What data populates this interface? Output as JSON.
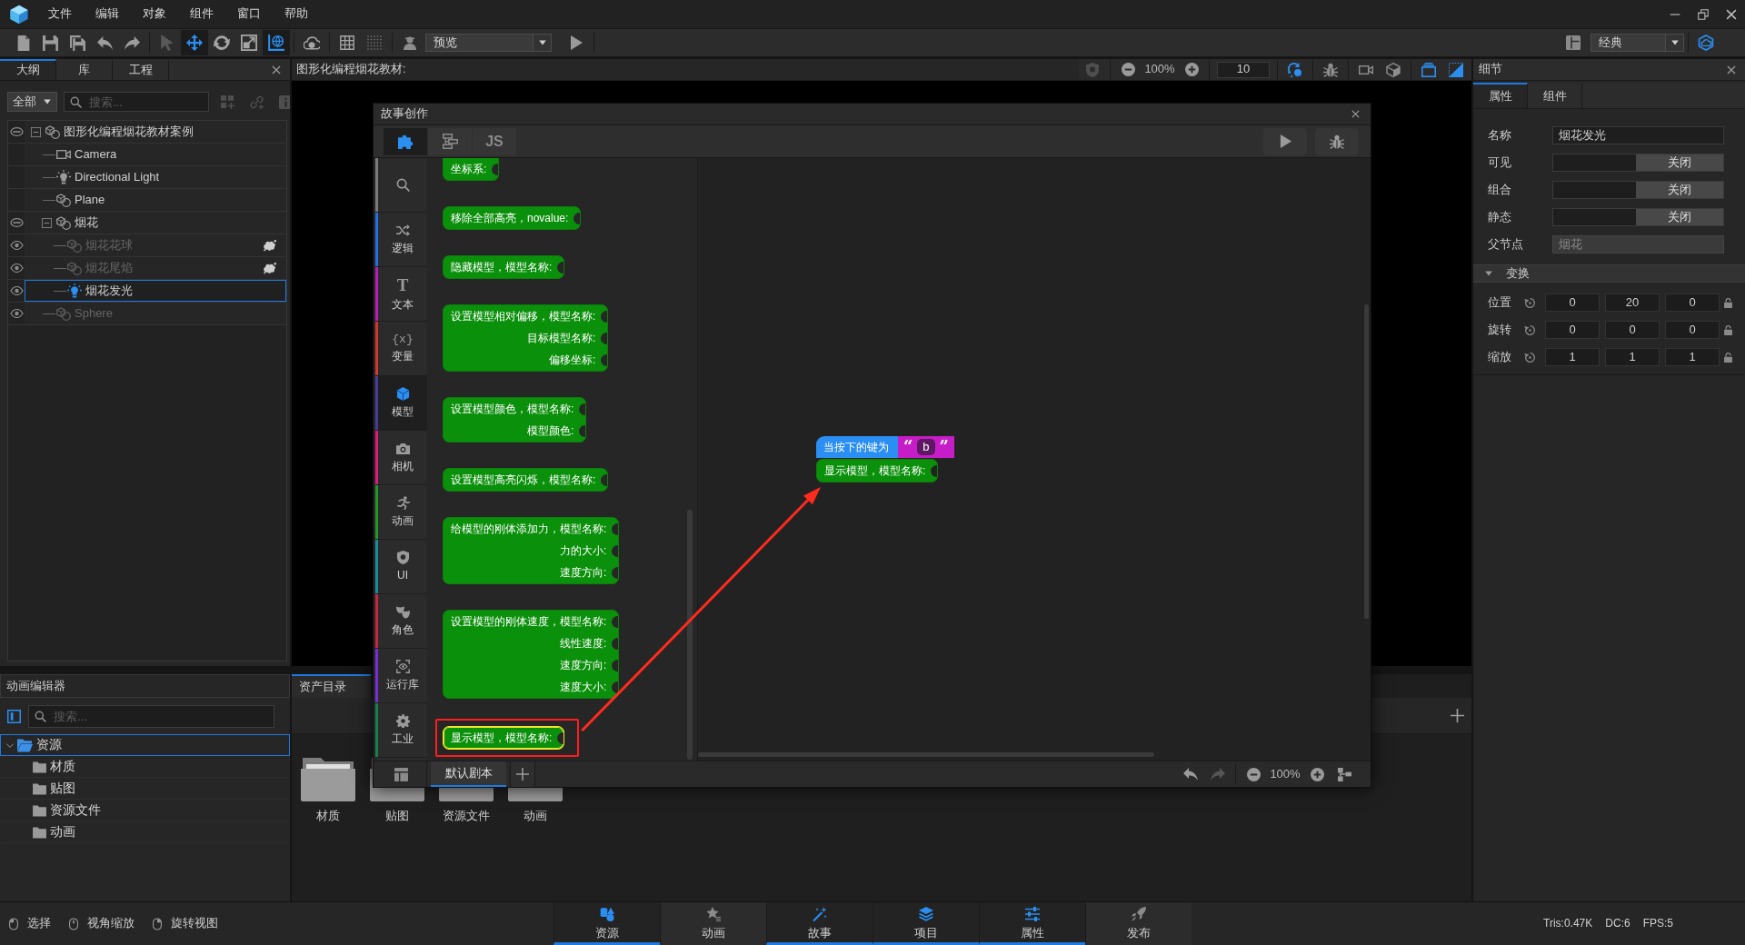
{
  "menu": [
    "文件",
    "编辑",
    "对象",
    "组件",
    "窗口",
    "帮助"
  ],
  "toolbar": {
    "tools": [
      {
        "kind": "select",
        "selected": false,
        "disabled": true
      },
      {
        "kind": "move",
        "selected": true,
        "disabled": false
      },
      {
        "kind": "rotate",
        "selected": false,
        "disabled": false
      },
      {
        "kind": "scale",
        "selected": false,
        "disabled": false
      },
      {
        "kind": "world",
        "selected": true,
        "disabled": false
      }
    ],
    "mode": "预览",
    "layout": "经典"
  },
  "outline": {
    "tabs": [
      {
        "label": "大纲",
        "selected": true
      },
      {
        "label": "库",
        "selected": false
      },
      {
        "label": "工程",
        "selected": false
      }
    ],
    "filter": "全部",
    "search": {
      "placeholder": "搜索..."
    },
    "tree": [
      {
        "label": "图形化编程烟花教材案例",
        "kind": "model",
        "visibility_toggle": true,
        "expanded": true,
        "selected": false,
        "dimmed": false,
        "effect": false,
        "children": [
          {
            "label": "Camera",
            "kind": "camera",
            "visibility_toggle": false,
            "selected": false,
            "dimmed": false,
            "effect": false
          },
          {
            "label": "Directional Light",
            "kind": "light",
            "visibility_toggle": false,
            "selected": false,
            "dimmed": false,
            "effect": false
          },
          {
            "label": "Plane",
            "kind": "model",
            "visibility_toggle": false,
            "selected": false,
            "dimmed": false,
            "effect": false
          },
          {
            "label": "烟花",
            "kind": "model",
            "visibility_toggle": true,
            "expanded": true,
            "selected": false,
            "dimmed": false,
            "effect": false,
            "children": [
              {
                "label": "烟花花球",
                "kind": "model",
                "visibility_toggle": true,
                "selected": false,
                "dimmed": true,
                "effect": true
              },
              {
                "label": "烟花尾焰",
                "kind": "model",
                "visibility_toggle": true,
                "selected": false,
                "dimmed": true,
                "effect": true
              },
              {
                "label": "烟花发光",
                "kind": "light",
                "visibility_toggle": true,
                "selected": true,
                "dimmed": false,
                "effect": false
              }
            ]
          },
          {
            "label": "Sphere",
            "kind": "model",
            "visibility_toggle": true,
            "selected": false,
            "dimmed": true,
            "effect": false
          }
        ]
      }
    ]
  },
  "viewport": {
    "title": "图形化编程烟花教材:",
    "zoom": "100%",
    "grid_size": "10",
    "toggles": [
      {
        "kind": "snap",
        "selected": true
      },
      {
        "kind": "debug",
        "selected": false
      },
      {
        "kind": "camera",
        "selected": false
      },
      {
        "kind": "cube",
        "selected": false
      },
      {
        "kind": "layers",
        "selected": true
      },
      {
        "kind": "gradient",
        "selected": true
      }
    ]
  },
  "details": {
    "title": "细节",
    "tabs": [
      {
        "label": "属性",
        "selected": true
      },
      {
        "label": "组件",
        "selected": false
      }
    ],
    "fields": [
      {
        "label": "名称",
        "kind": "text",
        "value": "烟花发光",
        "disabled": false
      },
      {
        "label": "可见",
        "kind": "toggle",
        "value": "关闭",
        "on": false
      },
      {
        "label": "组合",
        "kind": "toggle",
        "value": "关闭",
        "on": false
      },
      {
        "label": "静态",
        "kind": "toggle",
        "value": "关闭",
        "on": false
      },
      {
        "label": "父节点",
        "kind": "text",
        "value": "烟花",
        "disabled": true
      }
    ],
    "section": {
      "title": "变换",
      "expanded": true,
      "rows": [
        {
          "label": "位置",
          "values": [
            "0",
            "20",
            "0"
          ]
        },
        {
          "label": "旋转",
          "values": [
            "0",
            "0",
            "0"
          ]
        },
        {
          "label": "缩放",
          "values": [
            "1",
            "1",
            "1"
          ]
        }
      ]
    }
  },
  "animation_editor": {
    "title": "动画编辑器",
    "search": {
      "placeholder": "搜索..."
    },
    "tree": [
      {
        "label": "资源",
        "expanded": true,
        "selected": true,
        "children": [
          {
            "label": "材质",
            "selected": false
          },
          {
            "label": "贴图",
            "selected": false
          },
          {
            "label": "资源文件",
            "selected": false
          },
          {
            "label": "动画",
            "selected": false
          }
        ]
      }
    ]
  },
  "assets": {
    "tab": "资产目录",
    "folders": [
      "材质",
      "贴图",
      "资源文件",
      "动画"
    ]
  },
  "story": {
    "title": "故事创作",
    "tabs": [
      {
        "kind": "blocks",
        "selected": true
      },
      {
        "kind": "flow",
        "selected": false
      },
      {
        "kind": "code",
        "label": "JS",
        "selected": false
      }
    ],
    "categories": [
      {
        "kind": "search",
        "color": "#7a7a7a",
        "selected": false
      },
      {
        "kind": "logic",
        "label": "逻辑",
        "color": "#1f6fe5",
        "selected": false
      },
      {
        "kind": "text",
        "glyph": "T",
        "label": "文本",
        "color": "#b81bb8",
        "selected": false
      },
      {
        "kind": "variable",
        "glyph": "{x}",
        "label": "变量",
        "color": "#d3362b",
        "selected": false
      },
      {
        "kind": "model",
        "label": "模型",
        "color": "#463c9c",
        "selected": true
      },
      {
        "kind": "camera",
        "label": "相机",
        "color": "#e0187c",
        "selected": false
      },
      {
        "kind": "animation",
        "label": "动画",
        "color": "#1e9a24",
        "selected": false
      },
      {
        "kind": "ui",
        "label": "UI",
        "color": "#188c9c",
        "selected": false
      },
      {
        "kind": "role",
        "label": "角色",
        "color": "#c8263d",
        "selected": false
      },
      {
        "kind": "library",
        "label": "运行库",
        "color": "#7a2dd6",
        "selected": false
      },
      {
        "kind": "industry",
        "label": "工业",
        "color": "#167f4a",
        "selected": false
      }
    ],
    "palette": [
      {
        "lines": [
          "坐标系:"
        ],
        "clipped": true,
        "selected": false,
        "highlighted": false
      },
      {
        "lines": [
          "移除全部高亮，novalue:"
        ],
        "clipped": false,
        "selected": false,
        "highlighted": false
      },
      {
        "lines": [
          "隐藏模型，模型名称:"
        ],
        "clipped": false,
        "selected": false,
        "highlighted": false
      },
      {
        "lines": [
          "设置模型相对偏移，模型名称:",
          "目标模型名称:",
          "偏移坐标:"
        ],
        "clipped": false,
        "selected": false,
        "highlighted": false
      },
      {
        "lines": [
          "设置模型颜色，模型名称:",
          "模型颜色:"
        ],
        "clipped": false,
        "selected": false,
        "highlighted": false
      },
      {
        "lines": [
          "设置模型高亮闪烁，模型名称:"
        ],
        "clipped": false,
        "selected": false,
        "highlighted": false
      },
      {
        "lines": [
          "给模型的刚体添加力，模型名称:",
          "力的大小:",
          "速度方向:"
        ],
        "clipped": false,
        "selected": false,
        "highlighted": false
      },
      {
        "lines": [
          "设置模型的刚体速度，模型名称:",
          "线性速度:",
          "速度方向:",
          "速度大小:"
        ],
        "clipped": false,
        "selected": false,
        "highlighted": false
      },
      {
        "lines": [
          "显示模型，模型名称:"
        ],
        "clipped": false,
        "selected": true,
        "highlighted": true
      }
    ],
    "workspace": {
      "event": {
        "label": "当按下的键为",
        "quotes": [
          "“",
          "”"
        ],
        "key": "b"
      },
      "statements": [
        {
          "lines": [
            "显示模型，模型名称:"
          ],
          "selected": false
        }
      ]
    },
    "scripts": [
      {
        "label": "默认剧本",
        "selected": true
      }
    ],
    "zoom": "100%"
  },
  "status_bar": {
    "hints": [
      {
        "kind": "left",
        "label": "选择"
      },
      {
        "kind": "middle",
        "label": "视角缩放"
      },
      {
        "kind": "right",
        "label": "旋转视图"
      }
    ],
    "tabs": [
      {
        "kind": "assets",
        "label": "资源",
        "selected": true
      },
      {
        "kind": "animation",
        "label": "动画",
        "selected": false
      },
      {
        "kind": "story",
        "label": "故事",
        "selected": true
      },
      {
        "kind": "project",
        "label": "项目",
        "selected": true
      },
      {
        "kind": "properties",
        "label": "属性",
        "selected": true
      },
      {
        "kind": "publish",
        "label": "发布",
        "selected": false
      }
    ],
    "stats": [
      "Tris:0.47K",
      "DC:6",
      "FPS:5"
    ]
  }
}
